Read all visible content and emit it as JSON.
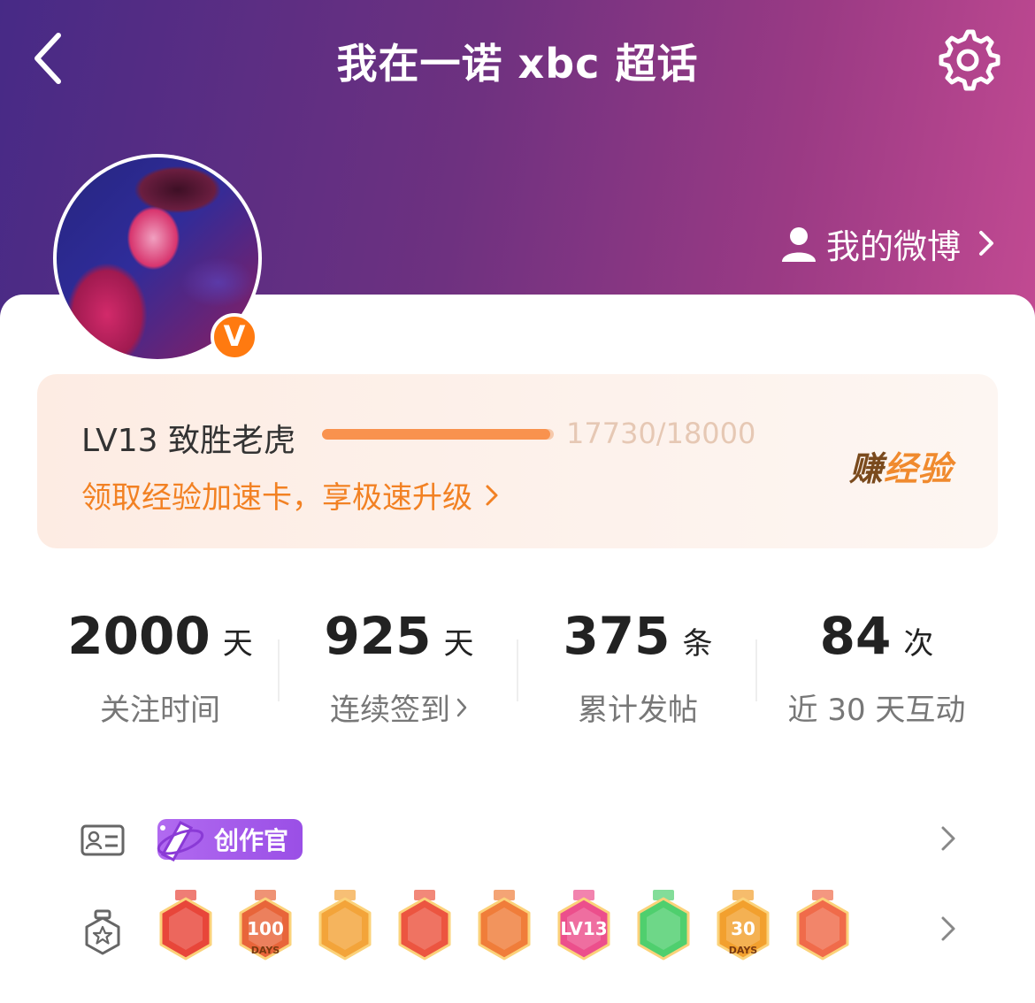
{
  "header": {
    "title": "我在一诺 xbc 超话",
    "back_icon": "chevron-left-icon",
    "settings_icon": "gear-icon",
    "my_weibo_label": "我的微博"
  },
  "profile": {
    "verified_badge": "V"
  },
  "level": {
    "label": "LV13 致胜老虎",
    "progress_text": "17730/18000",
    "progress_value": 17730,
    "progress_max": 18000,
    "link_text": "领取经验加速卡，享极速升级",
    "earn_prefix": "赚",
    "earn_suffix": "经验"
  },
  "stats": [
    {
      "value": "2000",
      "unit": "天",
      "label": "关注时间"
    },
    {
      "value": "925",
      "unit": "天",
      "label": "连续签到",
      "has_arrow": true
    },
    {
      "value": "375",
      "unit": "条",
      "label": "累计发帖"
    },
    {
      "value": "84",
      "unit": "次",
      "label": "近 30 天互动"
    }
  ],
  "badges": {
    "title_chip": "创作官",
    "medals": [
      {
        "name": "mascot-medal",
        "color": "#e8463a",
        "text": ""
      },
      {
        "name": "100-days-medal",
        "color": "#e8653a",
        "text": "100",
        "sub": "DAYS"
      },
      {
        "name": "crown-medal",
        "color": "#f3a43a",
        "text": ""
      },
      {
        "name": "mascot-medal-2",
        "color": "#ec5540",
        "text": ""
      },
      {
        "name": "fire-mascot-medal",
        "color": "#f07d3a",
        "text": ""
      },
      {
        "name": "lv13-medal",
        "color": "#ec4f8c",
        "text": "LV13"
      },
      {
        "name": "hand-medal",
        "color": "#4fcf6e",
        "text": ""
      },
      {
        "name": "30-days-medal",
        "color": "#f2a02e",
        "text": "30",
        "sub": "DAYS"
      },
      {
        "name": "rock-hand-medal",
        "color": "#f06b4a",
        "text": ""
      }
    ]
  },
  "colors": {
    "accent_orange": "#f28123",
    "header_start": "#472a86",
    "header_end": "#c24a92",
    "chip_purple": "#9a4fe6"
  }
}
